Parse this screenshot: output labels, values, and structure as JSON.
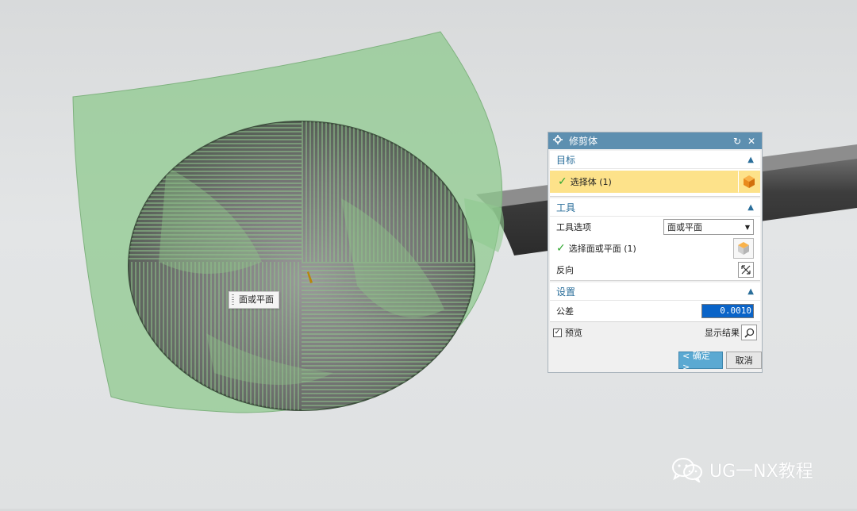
{
  "viewport": {
    "tooltip_label": "面或平面"
  },
  "dialog": {
    "title": "修剪体",
    "target": {
      "header": "目标",
      "select_body": "选择体 (1)"
    },
    "tool": {
      "header": "工具",
      "tool_option_label": "工具选项",
      "tool_option_value": "面或平面",
      "select_face": "选择面或平面 (1)",
      "reverse_label": "反向"
    },
    "settings": {
      "header": "设置",
      "tolerance_label": "公差",
      "tolerance_value": "0.0010"
    },
    "preview_label": "预览",
    "show_result_label": "显示结果",
    "ok_label": "< 确定 >",
    "cancel_label": "取消"
  },
  "watermark": {
    "text": "UG一NX教程"
  },
  "colors": {
    "titlebar": "#5d8fb0",
    "section_header": "#2a6e9a",
    "selected_row": "#fde28a",
    "ok_button": "#5ba9d2",
    "sheet_green": "#8fc98f",
    "sphere_gray": "#6f6f6f"
  },
  "icons": [
    "settings-icon",
    "reset-icon",
    "close-icon",
    "chevron-up-icon",
    "check-icon",
    "cube-icon",
    "reverse-icon",
    "search-icon",
    "wechat-icon"
  ]
}
